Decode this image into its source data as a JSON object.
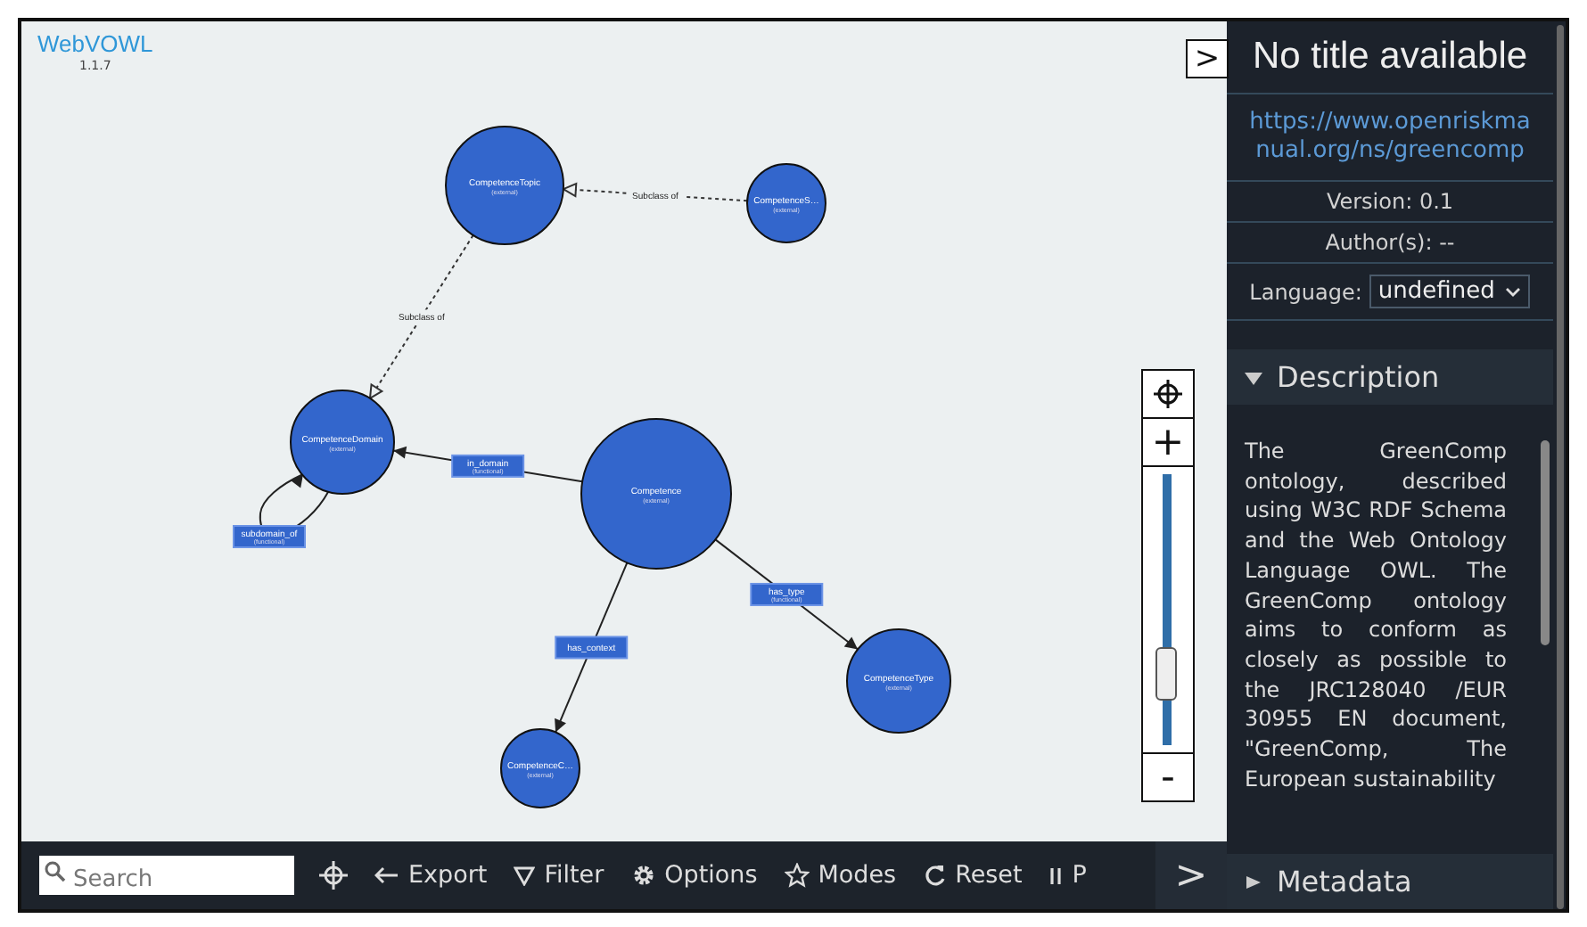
{
  "app": {
    "name": "WebVOWL",
    "version": "1.1.7"
  },
  "graph": {
    "nodes": [
      {
        "name": "CompetenceTopic",
        "subtitle": "(external)"
      },
      {
        "name": "CompetenceS…",
        "subtitle": "(external)"
      },
      {
        "name": "CompetenceDomain",
        "subtitle": "(external)"
      },
      {
        "name": "Competence",
        "subtitle": "(external)"
      },
      {
        "name": "CompetenceType",
        "subtitle": "(external)"
      },
      {
        "name": "CompetenceC…",
        "subtitle": "(external)"
      }
    ],
    "edges": [
      {
        "kind": "subclass",
        "label": "Subclass of"
      },
      {
        "kind": "subclass",
        "label": "Subclass of"
      },
      {
        "kind": "property",
        "label": "in_domain",
        "subtitle": "(functional)"
      },
      {
        "kind": "property",
        "label": "subdomain_of",
        "subtitle": "(functional)"
      },
      {
        "kind": "property",
        "label": "has_type",
        "subtitle": "(functional)"
      },
      {
        "kind": "property",
        "label": "has_context"
      }
    ]
  },
  "zoom": {
    "plus": "+",
    "minus": "-",
    "level": 0.2
  },
  "sidebar_toggle_top": ">",
  "toolbar": {
    "search": {
      "placeholder": "Search"
    },
    "items": [
      {
        "kind": "locate"
      },
      {
        "kind": "export",
        "label": "Export"
      },
      {
        "kind": "filter",
        "label": "Filter"
      },
      {
        "kind": "options",
        "label": "Options"
      },
      {
        "kind": "modes",
        "label": "Modes"
      },
      {
        "kind": "reset",
        "label": "Reset"
      },
      {
        "kind": "pause",
        "label": "P"
      }
    ],
    "toggle": ">"
  },
  "sidebar": {
    "title": "No title available",
    "iri": "https://www.openriskmanual.org/ns/greencomp",
    "version": "Version: 0.1",
    "authors": "Author(s): --",
    "language_label": "Language:",
    "language": "undefined",
    "sections": [
      {
        "title": "Description",
        "expanded": true,
        "text": "The GreenComp ontology, described using W3C RDF Schema and the Web Ontology Language OWL. The GreenComp ontology aims to conform as closely as possible to the JRC128040 /EUR 30955 EN document, \"GreenComp, The European sustainability"
      },
      {
        "title": "Metadata",
        "expanded": false
      }
    ]
  }
}
